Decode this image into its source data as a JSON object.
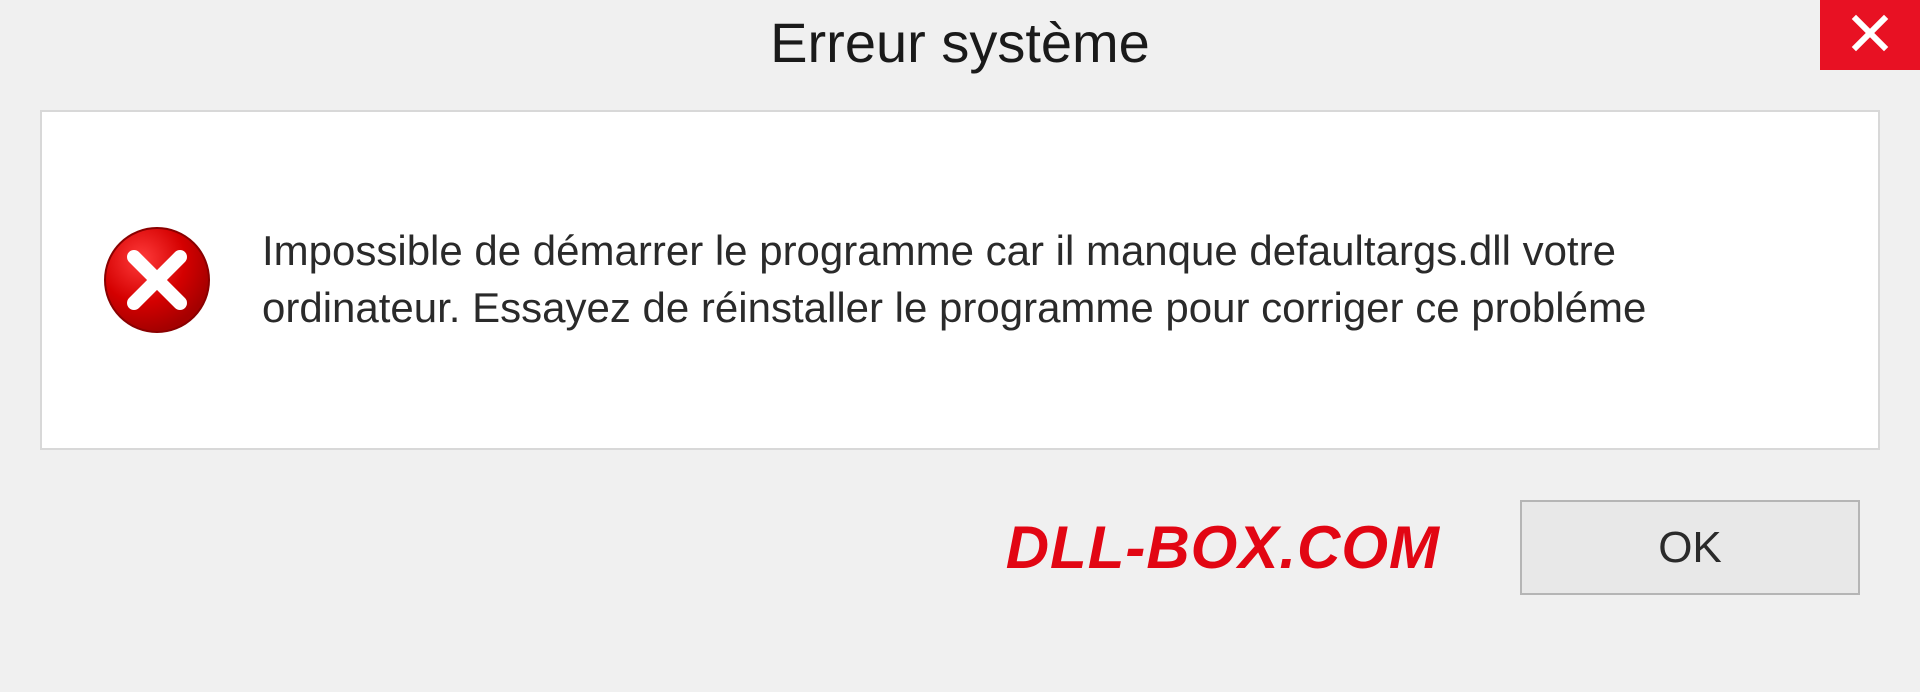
{
  "dialog": {
    "title": "Erreur système",
    "message": "Impossible de démarrer le programme car il manque defaultargs.dll votre ordinateur. Essayez de réinstaller le programme pour corriger ce probléme",
    "ok_label": "OK"
  },
  "watermark": "DLL-BOX.COM",
  "colors": {
    "close_bg": "#e81123",
    "error_icon": "#d40000",
    "watermark": "#e20613"
  }
}
